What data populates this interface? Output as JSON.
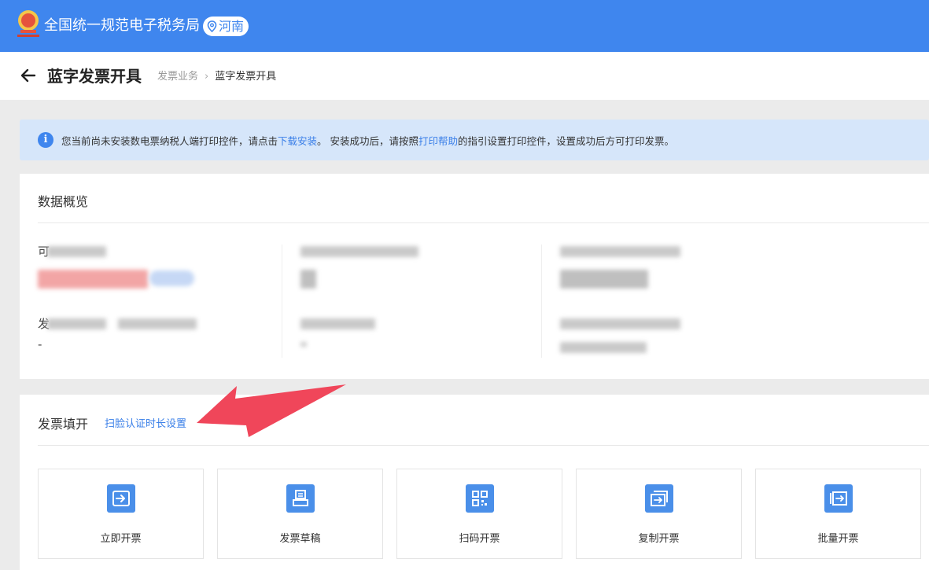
{
  "topbar": {
    "title": "全国统一规范电子税务局",
    "region": "河南"
  },
  "page": {
    "title": "蓝字发票开具",
    "breadcrumb_parent": "发票业务",
    "breadcrumb_current": "蓝字发票开具"
  },
  "notice": {
    "part1": "您当前尚未安装数电票纳税人端打印控件，请点击",
    "link_download": "下载安装",
    "part2": "。 安装成功后，请按照",
    "link_help": "打印帮助",
    "part3": "的指引设置打印控件，设置成功后方可打印发票。"
  },
  "overview": {
    "title": "数据概览",
    "col1_label_char": "可",
    "col1_label2_char": "发",
    "col1_dash": "-"
  },
  "invoice": {
    "title": "发票填开",
    "scan_link": "扫脸认证时长设置",
    "tiles": [
      {
        "label": "立即开票",
        "icon": "issue-now-icon"
      },
      {
        "label": "发票草稿",
        "icon": "draft-icon"
      },
      {
        "label": "扫码开票",
        "icon": "qrcode-icon"
      },
      {
        "label": "复制开票",
        "icon": "copy-invoice-icon"
      },
      {
        "label": "批量开票",
        "icon": "batch-invoice-icon"
      }
    ]
  },
  "colors": {
    "brand": "#3f86ee",
    "annotation_arrow": "#f0465a",
    "tile_icon": "#4a8fe9"
  }
}
